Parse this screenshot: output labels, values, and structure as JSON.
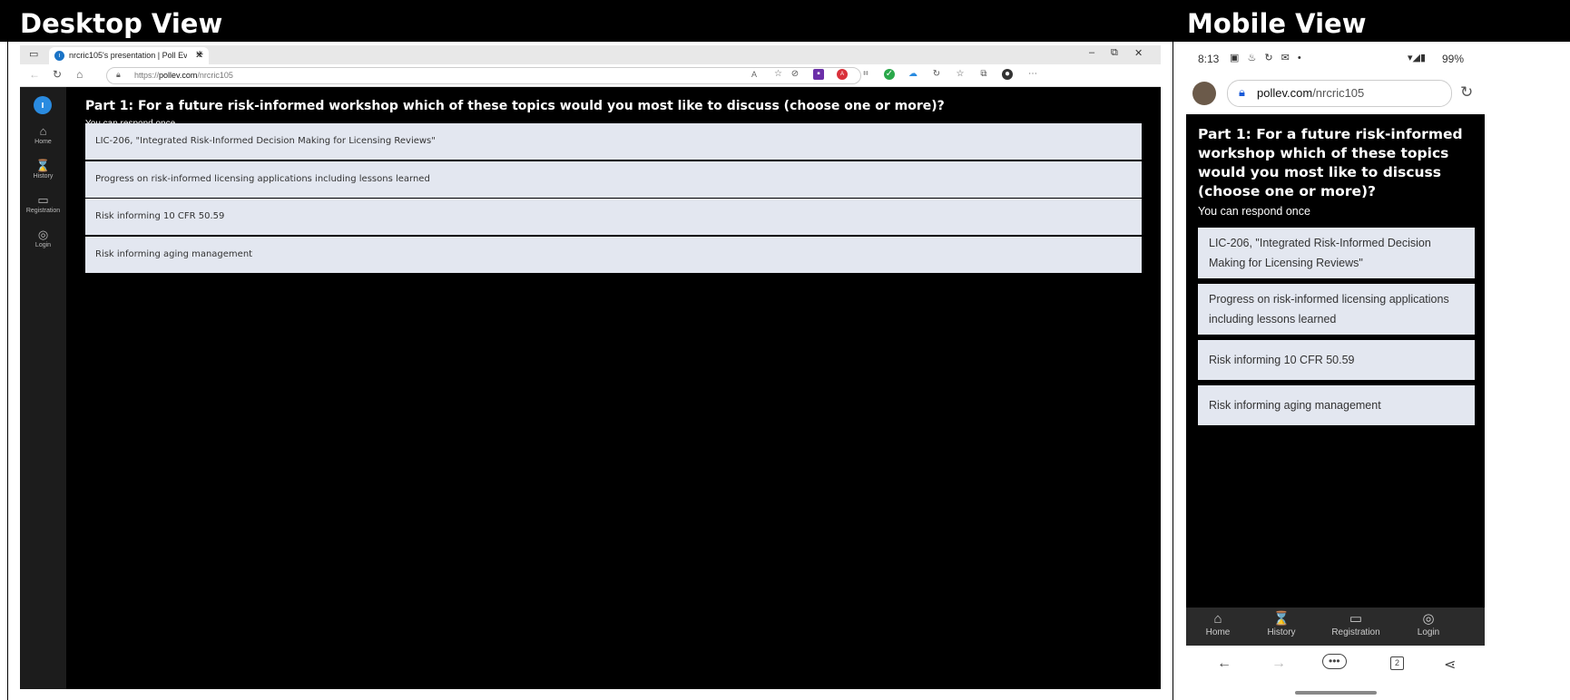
{
  "headings": {
    "desktop": "Desktop View",
    "mobile": "Mobile View"
  },
  "desktop": {
    "tab_title": "nrcric105's presentation | Poll Ev",
    "url_prefix": "https://",
    "url_domain": "pollev.com",
    "url_path": "/nrcric105",
    "sidebar": [
      {
        "icon": "home-icon",
        "label": "Home"
      },
      {
        "icon": "history-icon",
        "label": "History"
      },
      {
        "icon": "registration-icon",
        "label": "Registration"
      },
      {
        "icon": "login-icon",
        "label": "Login"
      }
    ]
  },
  "poll": {
    "question": "Part 1: For a future risk-informed workshop which of these topics would you most like to discuss (choose one or more)?",
    "subtitle": "You can respond once",
    "options": [
      "LIC-206, \"Integrated Risk-Informed Decision Making for Licensing Reviews\"",
      "Progress on risk-informed licensing applications including lessons learned",
      "Risk informing 10 CFR 50.59",
      "Risk informing aging management"
    ]
  },
  "mobile": {
    "time": "8:13",
    "battery": "99%",
    "url_domain": "pollev.com",
    "url_path": "/nrcric105",
    "tabs_count": "2",
    "nav": [
      {
        "icon": "home-icon",
        "label": "Home"
      },
      {
        "icon": "history-icon",
        "label": "History"
      },
      {
        "icon": "registration-icon",
        "label": "Registration"
      },
      {
        "icon": "login-icon",
        "label": "Login"
      }
    ]
  }
}
